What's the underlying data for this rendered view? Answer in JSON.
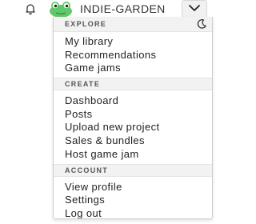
{
  "header": {
    "username": "INDIE-GARDEN",
    "icons": {
      "notifications": "bell-icon",
      "avatar": "frog-avatar",
      "menu_toggle": "chevron-down-icon",
      "theme": "moon-icon"
    }
  },
  "menu": {
    "sections": [
      {
        "title": "EXPLORE",
        "items": [
          "My library",
          "Recommendations",
          "Game jams"
        ]
      },
      {
        "title": "CREATE",
        "items": [
          "Dashboard",
          "Posts",
          "Upload new project",
          "Sales & bundles",
          "Host game jam"
        ]
      },
      {
        "title": "ACCOUNT",
        "items": [
          "View profile",
          "Settings",
          "Log out"
        ]
      }
    ]
  },
  "colors": {
    "avatar_green": "#5fc86a",
    "header_bg": "#f2f2f2",
    "text": "#222222"
  }
}
